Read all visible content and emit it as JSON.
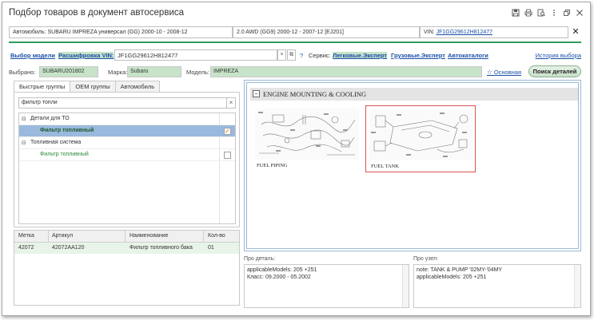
{
  "window": {
    "title": "Подбор товаров в документ автосервиса"
  },
  "vehicle_row": {
    "car_label": "Автомобиль:",
    "car_value": "SUBARU IMPREZA универсал (GG) 2000-10 - 2008-12",
    "engine_value": "2.0 AWD (GG9) 2000-12 - 2007-12 [EJ201]",
    "vin_label": "VIN:",
    "vin_value": "JF1GG29612H812477",
    "close_label": "✕"
  },
  "mode_row": {
    "model_select": "Выбор модели",
    "vin_decode": "Расшифровка VIN:",
    "vin_input": "JF1GG29612H812477",
    "clear": "×",
    "copy": "⧉",
    "help": "?",
    "service_label": "Сервис:",
    "services": [
      "Легковые.Эксперт",
      "Грузовые.Эксперт",
      "Автокаталоги"
    ],
    "history": "История выбора"
  },
  "selection_row": {
    "selected_label": "Выбрано:",
    "selected_value": "SUBARU201802",
    "brand_label": "Марка:",
    "brand_value": "Subaru",
    "model_label": "Модель:",
    "model_value": "IMPREZA",
    "main_link": "Основная",
    "search_button": "Поиск деталей"
  },
  "left_tabs": [
    "Быстрые группы",
    "OEM группы",
    "Автомобиль"
  ],
  "filter": {
    "value": "фильтр топли",
    "clear": "×"
  },
  "tree": [
    {
      "label": "Детали для ТО",
      "expander": "⊟",
      "checked": false
    },
    {
      "label": "Фильтр топливный",
      "checked": true
    },
    {
      "label": "Топливная система",
      "expander": "⊟",
      "checked": false
    },
    {
      "label": "Фильтр топливный",
      "checked": false
    }
  ],
  "grid": {
    "headers": [
      "Метка",
      "Артикул",
      "Наименование",
      "Кол-во"
    ],
    "rows": [
      [
        "42072",
        "42072AA120",
        "Фильтр топливного бака",
        "01"
      ]
    ]
  },
  "assembly": {
    "collapse": "−",
    "title": "ENGINE MOUNTING & COOLING",
    "items": [
      {
        "label": "FUEL PIPING",
        "selected": false
      },
      {
        "label": "FUEL TANK",
        "selected": true
      }
    ]
  },
  "detail_info": {
    "label": "Про деталь:",
    "lines": [
      "applicableModels: 205 +251",
      "Класс: 09.2000 - 05.2002"
    ]
  },
  "node_info": {
    "label": "Про узел:",
    "lines": [
      "note: TANK & PUMP '02MY-'04MY",
      "applicableModels: 205 +251"
    ]
  },
  "colors": {
    "accent_green": "#2e9d5b",
    "highlight_green": "#c7e3c9",
    "link_blue": "#1a4ea8",
    "tree_selection": "#9ab9dd",
    "thumb_selected_border": "#d9534f"
  }
}
